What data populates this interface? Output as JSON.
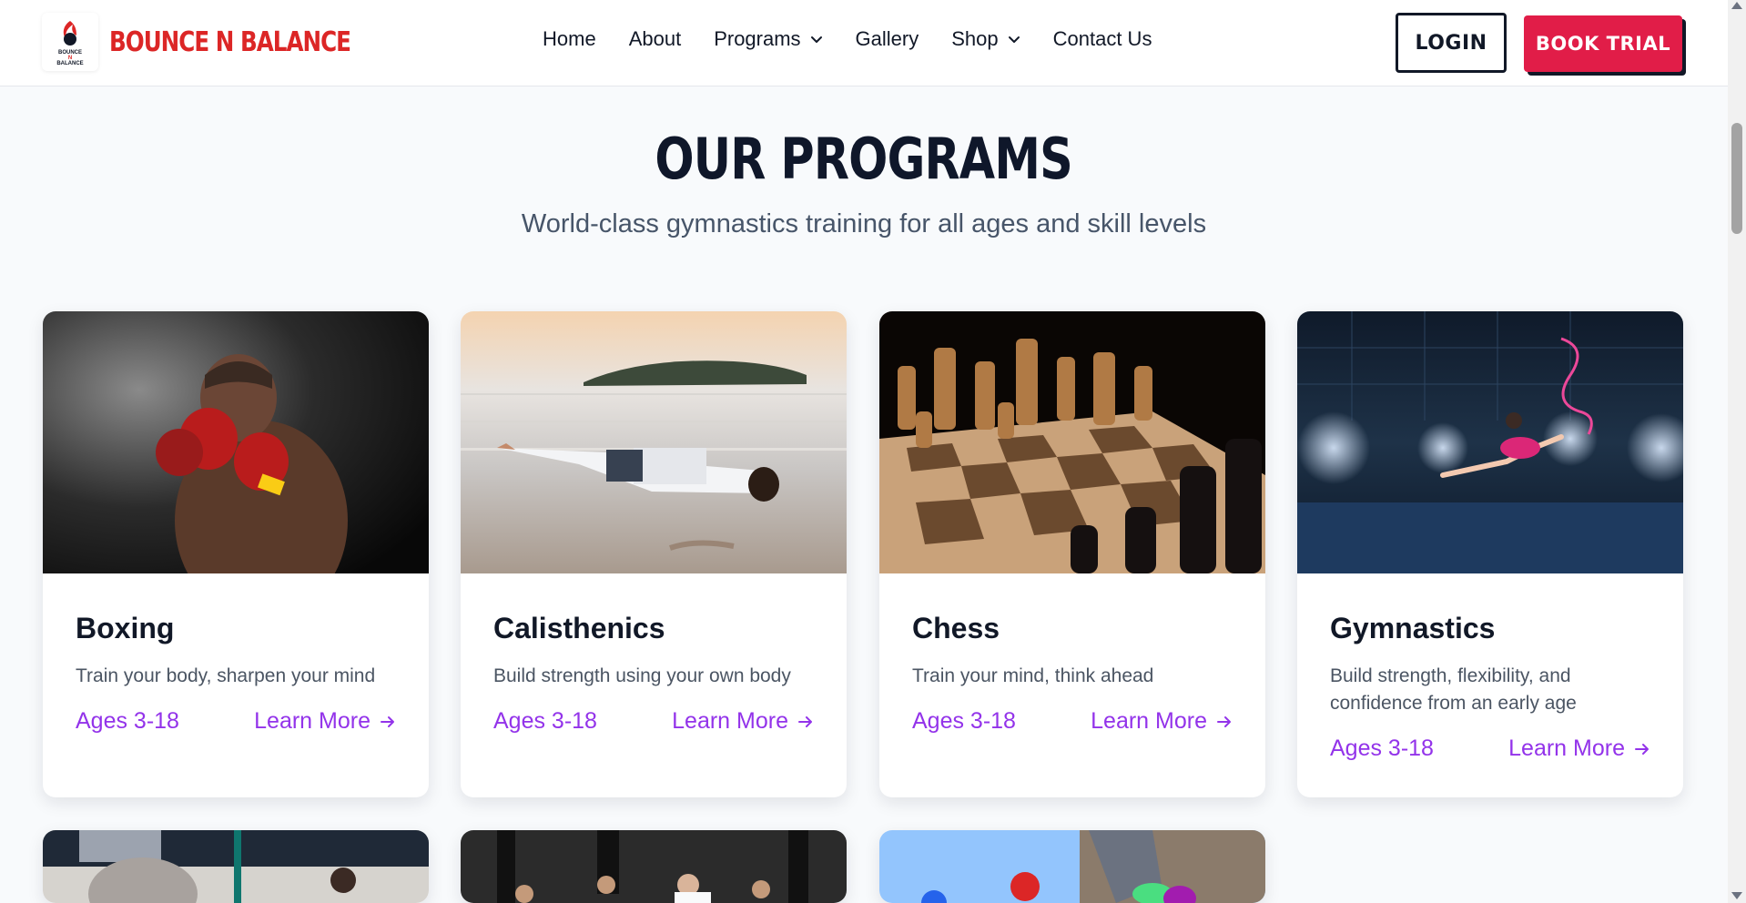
{
  "header": {
    "brand_name": "BOUNCE N BALANCE",
    "logo_text": [
      "BOUNCE",
      "N",
      "BALANCE"
    ],
    "nav": [
      {
        "label": "Home",
        "has_dropdown": false
      },
      {
        "label": "About",
        "has_dropdown": false
      },
      {
        "label": "Programs",
        "has_dropdown": true
      },
      {
        "label": "Gallery",
        "has_dropdown": false
      },
      {
        "label": "Shop",
        "has_dropdown": true
      },
      {
        "label": "Contact Us",
        "has_dropdown": false
      }
    ],
    "login_label": "LOGIN",
    "trial_label": "BOOK TRIAL"
  },
  "colors": {
    "brand_red": "#dc2626",
    "cta_red": "#e11d48",
    "accent_purple": "#9333ea",
    "heading": "#0f172a",
    "page_bg": "#f8fafc"
  },
  "programs": {
    "title": "OUR PROGRAMS",
    "subtitle": "World-class gymnastics training for all ages and skill levels",
    "cards": [
      {
        "title": "Boxing",
        "description": "Train your body, sharpen your mind",
        "ages": "Ages 3-18",
        "link": "Learn More",
        "image": "boxer-photo"
      },
      {
        "title": "Calisthenics",
        "description": "Build strength using your own body",
        "ages": "Ages 3-18",
        "link": "Learn More",
        "image": "beach-pushup-photo"
      },
      {
        "title": "Chess",
        "description": "Train your mind, think ahead",
        "ages": "Ages 3-18",
        "link": "Learn More",
        "image": "chessboard-photo"
      },
      {
        "title": "Gymnastics",
        "description": "Build strength, flexibility, and confidence from an early age",
        "ages": "Ages 3-18",
        "link": "Learn More",
        "image": "rhythmic-gymnast-photo"
      }
    ],
    "more_cards_images": [
      "class-photo",
      "martial-arts-photo",
      "kids-playing-photo"
    ]
  },
  "icons": {
    "dropdown": "chevron-down-icon",
    "learn_more": "arrow-right-icon",
    "scroll_up": "scroll-up-arrow",
    "scroll_down": "scroll-down-arrow"
  }
}
